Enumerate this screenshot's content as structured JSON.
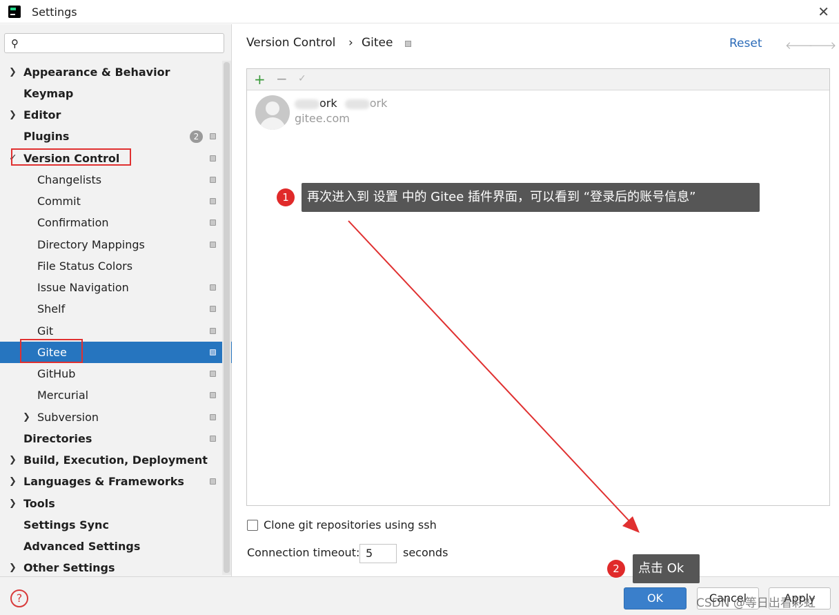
{
  "window": {
    "title": "Settings"
  },
  "search": {
    "placeholder": ""
  },
  "sidebar": {
    "items": [
      {
        "label": "Appearance & Behavior"
      },
      {
        "label": "Keymap"
      },
      {
        "label": "Editor"
      },
      {
        "label": "Plugins",
        "badge": "2"
      },
      {
        "label": "Version Control"
      },
      {
        "label": "Changelists"
      },
      {
        "label": "Commit"
      },
      {
        "label": "Confirmation"
      },
      {
        "label": "Directory Mappings"
      },
      {
        "label": "File Status Colors"
      },
      {
        "label": "Issue Navigation"
      },
      {
        "label": "Shelf"
      },
      {
        "label": "Git"
      },
      {
        "label": "Gitee"
      },
      {
        "label": "GitHub"
      },
      {
        "label": "Mercurial"
      },
      {
        "label": "Subversion"
      },
      {
        "label": "Directories"
      },
      {
        "label": "Build, Execution, Deployment"
      },
      {
        "label": "Languages & Frameworks"
      },
      {
        "label": "Tools"
      },
      {
        "label": "Settings Sync"
      },
      {
        "label": "Advanced Settings"
      },
      {
        "label": "Other Settings"
      }
    ],
    "selected": "Gitee"
  },
  "header": {
    "breadcrumb": [
      "Version Control",
      "Gitee"
    ],
    "separator": "›",
    "reset_label": "Reset"
  },
  "accounts": {
    "toolbar": {
      "add": "+",
      "remove": "−",
      "check": "✓"
    },
    "list": [
      {
        "name_part1": "ork",
        "name_part2": "ork",
        "server": "gitee.com"
      }
    ]
  },
  "annotations": {
    "step1": {
      "number": "1",
      "text": "再次进入到 设置 中的 Gitee 插件界面，可以看到 “登录后的账号信息”"
    },
    "step2": {
      "number": "2",
      "text": "点击 Ok"
    }
  },
  "options": {
    "clone_ssh_label": "Clone git repositories using ssh",
    "clone_ssh_checked": false,
    "timeout_label": "Connection timeout:",
    "timeout_value": "5",
    "timeout_unit": "seconds"
  },
  "footer": {
    "help": "?",
    "ok_label": "OK",
    "cancel_label": "Cancel",
    "apply_label": "Apply"
  },
  "watermark": "CSDN @等日出看彩虹",
  "colors": {
    "selection": "#2675bf",
    "annotation_red": "#e03030",
    "link": "#2b6bb8"
  }
}
